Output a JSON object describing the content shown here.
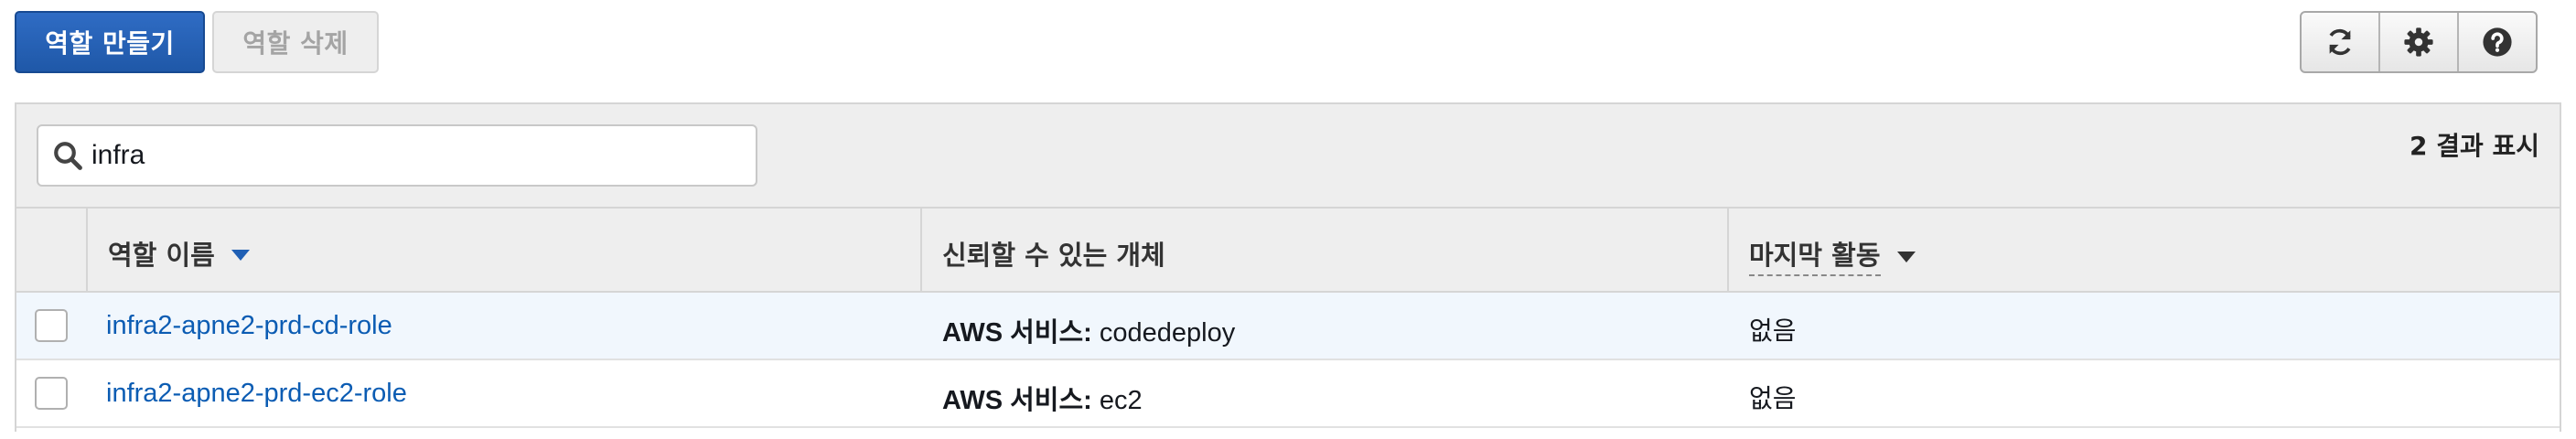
{
  "toolbar": {
    "create_role_label": "역할 만들기",
    "delete_role_label": "역할 삭제",
    "tools": [
      {
        "icon": "refresh-icon"
      },
      {
        "icon": "gear-icon"
      },
      {
        "icon": "help-icon"
      }
    ]
  },
  "filter": {
    "search_value": "infra",
    "search_icon": "search-icon",
    "result_count": "2 결과 표시"
  },
  "table": {
    "columns": [
      {
        "label": "역할 이름",
        "sortable": true
      },
      {
        "label": "신뢰할 수 있는 개체"
      },
      {
        "label": "마지막 활동",
        "sortable": true
      }
    ],
    "rows": [
      {
        "role_name": "infra2-apne2-prd-cd-role",
        "trusted_prefix": "AWS 서비스:",
        "trusted_value": " codedeploy",
        "last_activity": "없음"
      },
      {
        "role_name": "infra2-apne2-prd-ec2-role",
        "trusted_prefix": "AWS 서비스:",
        "trusted_value": " ec2",
        "last_activity": "없음"
      }
    ]
  },
  "colors": {
    "primary": "#1f58a8",
    "link": "#0b5cb3",
    "selected_row": "#f1f7fd"
  }
}
